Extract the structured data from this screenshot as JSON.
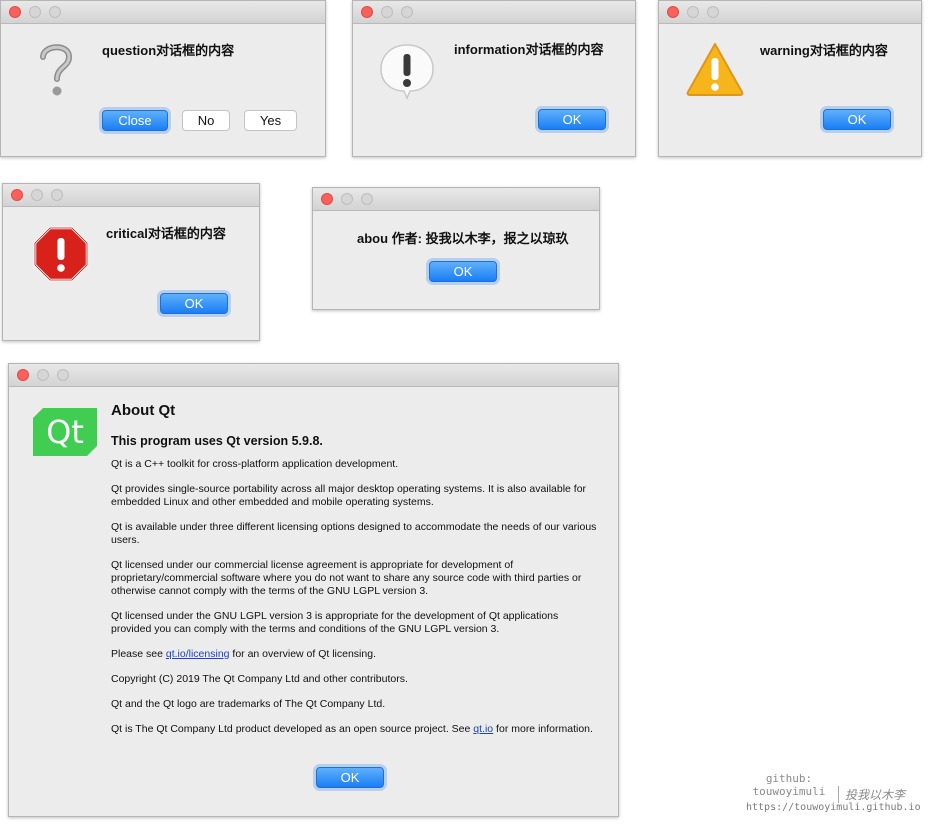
{
  "question_dialog": {
    "message": "question对话框的内容",
    "buttons": {
      "close": "Close",
      "no": "No",
      "yes": "Yes"
    }
  },
  "information_dialog": {
    "message": "information对话框的内容",
    "buttons": {
      "ok": "OK"
    }
  },
  "warning_dialog": {
    "message": "warning对话框的内容",
    "buttons": {
      "ok": "OK"
    }
  },
  "critical_dialog": {
    "message": "critical对话框的内容",
    "buttons": {
      "ok": "OK"
    }
  },
  "about_dialog": {
    "message": "abou 作者: 投我以木李，报之以琼玖",
    "buttons": {
      "ok": "OK"
    }
  },
  "about_qt_dialog": {
    "logo_text": "Qt",
    "title": "About Qt",
    "subtitle": "This program uses Qt version 5.9.8.",
    "paragraphs": [
      "Qt is a C++ toolkit for cross-platform application development.",
      "Qt provides single-source portability across all major desktop operating systems. It is also available for embedded Linux and other embedded and mobile operating systems.",
      "Qt is available under three different licensing options designed to accommodate the needs of our various users.",
      "Qt licensed under our commercial license agreement is appropriate for development of proprietary/commercial software where you do not want to share any source code with third parties or otherwise cannot comply with the terms of the GNU LGPL version 3.",
      "Qt licensed under the GNU LGPL version 3 is appropriate for the development of Qt applications provided you can comply with the terms and conditions of the GNU LGPL version 3."
    ],
    "licensing_pre": "Please see ",
    "licensing_link": "qt.io/licensing",
    "licensing_post": " for an overview of Qt licensing.",
    "copyright": "Copyright (C) 2019 The Qt Company Ltd and other contributors.",
    "trademark": "Qt and the Qt logo are trademarks of The Qt Company Ltd.",
    "product_pre": "Qt is The Qt Company Ltd product developed as an open source project. See ",
    "product_link": "qt.io",
    "product_post": " for more information.",
    "buttons": {
      "ok": "OK"
    }
  },
  "watermark": {
    "github_label": "github:",
    "username": "touwoyimuli",
    "signature": "投我以木李",
    "url": "https://touwoyimuli.github.io"
  },
  "colors": {
    "accent": "#1a7ef5",
    "qt_green": "#41cd52",
    "critical_red": "#d8211b",
    "warning_yellow": "#f6b51a"
  }
}
